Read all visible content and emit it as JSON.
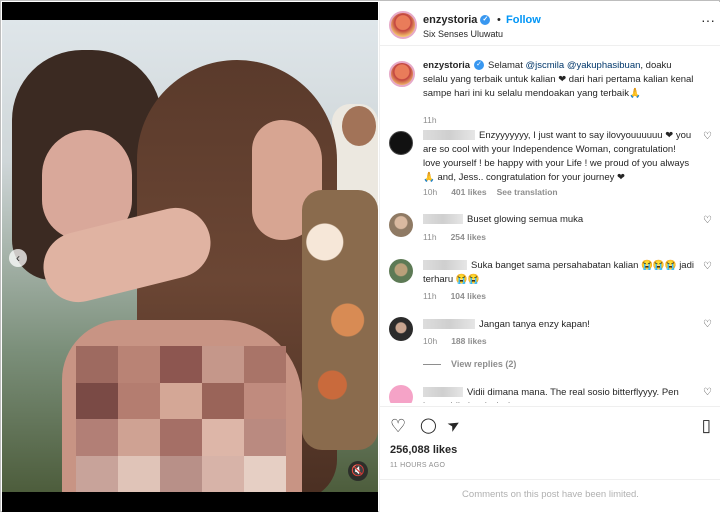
{
  "post": {
    "username": "enzystoria",
    "follow_label": "Follow",
    "location": "Six Senses Uluwatu",
    "dot": "•",
    "more": "···"
  },
  "caption": {
    "username": "enzystoria",
    "text_before": "Selamat ",
    "mention1": "@jscmila",
    "mention2": "@yakuphasibuan",
    "text_after": ", doaku selalu yang terbaik untuk kalian ❤ dari hari pertama kalian kenal sampe hari ini ku selalu mendoakan yang terbaik🙏",
    "time": "11h"
  },
  "comments": [
    {
      "text": "Enzyyyyyyy, I just want to say ilovyouuuuuu ❤ you are so cool with your Independence Woman, congratulation! love yourself ! be happy with your Life ! we proud of you always 🙏 and, Jess.. congratulation for your journey ❤",
      "time": "10h",
      "likes": "401 likes",
      "extra": "See translation"
    },
    {
      "text": "Buset glowing semua muka",
      "time": "11h",
      "likes": "254 likes"
    },
    {
      "text": "Suka banget sama persahabatan kalian 😭😭😭 jadi terharu 😭😭",
      "time": "11h",
      "likes": "104 likes"
    },
    {
      "text": "Jangan tanya enzy kapan!",
      "time": "10h",
      "likes": "188 likes"
    },
    {
      "text": "Vidii dimana mana. The real sosio bitterflyyyy. Pen kayu vidi aja wkwkwk"
    }
  ],
  "view_replies": "View replies (2)",
  "actions": {
    "like_icon": "♡",
    "comment_icon": "◯",
    "share_icon": "➤",
    "save_icon": "▯"
  },
  "likes_count": "256,088 likes",
  "time_ago": "11 HOURS AGO",
  "comments_limited": "Comments on this post have been limited.",
  "colors": {
    "link": "#0095f6",
    "mention": "#00376b",
    "muted": "#8e8e8e",
    "verified": "#3897f0"
  }
}
